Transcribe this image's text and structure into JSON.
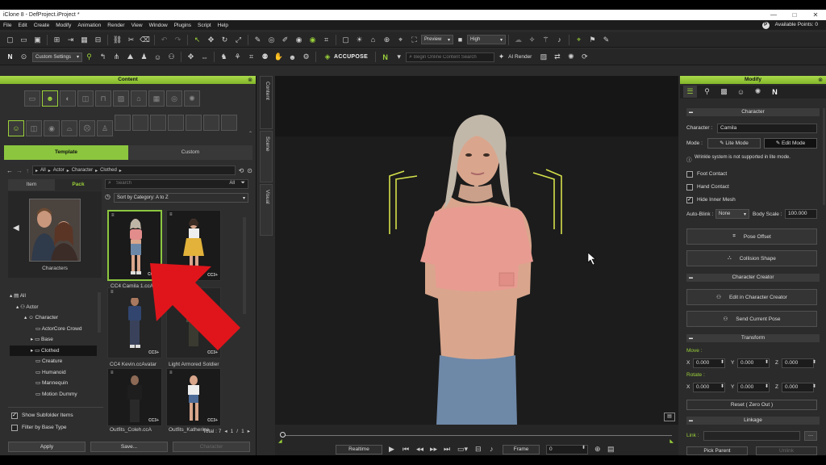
{
  "window": {
    "title": "iClone 8 - DefProject.iProject *",
    "min": "—",
    "max": "□",
    "close": "✕"
  },
  "menu": [
    "File",
    "Edit",
    "Create",
    "Modify",
    "Animation",
    "Render",
    "View",
    "Window",
    "Plugins",
    "Script",
    "Help"
  ],
  "available_points": "Available Points: 0",
  "toolbar1": {
    "preview": "Preview",
    "quality": "High"
  },
  "toolbar2": {
    "custom_settings": "Custom Settings",
    "accupose": "ACCUPOSE",
    "search_placeholder": "Begin Online Content Search",
    "ai_render": "AI Render"
  },
  "content": {
    "title": "Content",
    "tabs": {
      "template": "Template",
      "custom": "Custom"
    },
    "path": [
      "All",
      "Actor",
      "Character",
      "Clothed"
    ],
    "subtabs": {
      "item": "Item",
      "pack": "Pack"
    },
    "search_placeholder": "Search",
    "all": "All",
    "sort": "Sort by Category: A to Z",
    "preview_label": "Characters",
    "tree": [
      "All",
      "Actor",
      "Character",
      "ActorCore Crowd",
      "Base",
      "Clothed",
      "Creature",
      "Humanoid",
      "Mannequin",
      "Motion Dummy"
    ],
    "thumbs": [
      "CC4 Camila 1.ccAvatar",
      "",
      "CC4 Kevin.ccAvatar",
      "Light Armored Soldier",
      "Outfits_Coleh.ccA",
      "Outfits_Katherine"
    ],
    "cc3": "CC3+",
    "show_subfolder": "Show Subfolder Items",
    "filter_base": "Filter by Base Type",
    "total": "Total : 7",
    "page": "1",
    "page_sep": "/",
    "page_total": "1",
    "apply": "Apply",
    "save": "Save...",
    "character": "Character"
  },
  "side_tabs": [
    "Content",
    "Scene",
    "Visual"
  ],
  "modify": {
    "title": "Modify",
    "character_section": "Character",
    "character_label": "Character :",
    "character_value": "Camila",
    "mode_label": "Mode :",
    "lite_mode": "Lite Mode",
    "edit_mode": "Edit Mode",
    "wrinkle_note": "Wrinkle system is not supported in lite mode.",
    "foot_contact": "Foot Contact",
    "hand_contact": "Hand Contact",
    "hide_inner_mesh": "Hide Inner Mesh",
    "auto_blink_label": "Auto-Blink :",
    "auto_blink_value": "None",
    "body_scale_label": "Body Scale :",
    "body_scale_value": "100.000",
    "pose_offset": "Pose Offset",
    "collision_shape": "Collision Shape",
    "character_creator_section": "Character Creator",
    "edit_in_cc": "Edit in Character Creator",
    "send_current_pose": "Send Current Pose",
    "transform_section": "Transform",
    "move": "Move :",
    "rotate": "Rotate :",
    "x": "X",
    "y": "Y",
    "z": "Z",
    "move_vals": [
      "0.000",
      "0.000",
      "0.000"
    ],
    "rotate_vals": [
      "0.000",
      "0.000",
      "0.000"
    ],
    "reset": "Reset ( Zero Out )",
    "linkage_section": "Linkage",
    "link_label": "Link :",
    "pick_parent": "Pick Parent",
    "unlink": "Unlink"
  },
  "playback": {
    "realtime": "Realtime",
    "frame": "Frame",
    "frame_value": "0"
  }
}
